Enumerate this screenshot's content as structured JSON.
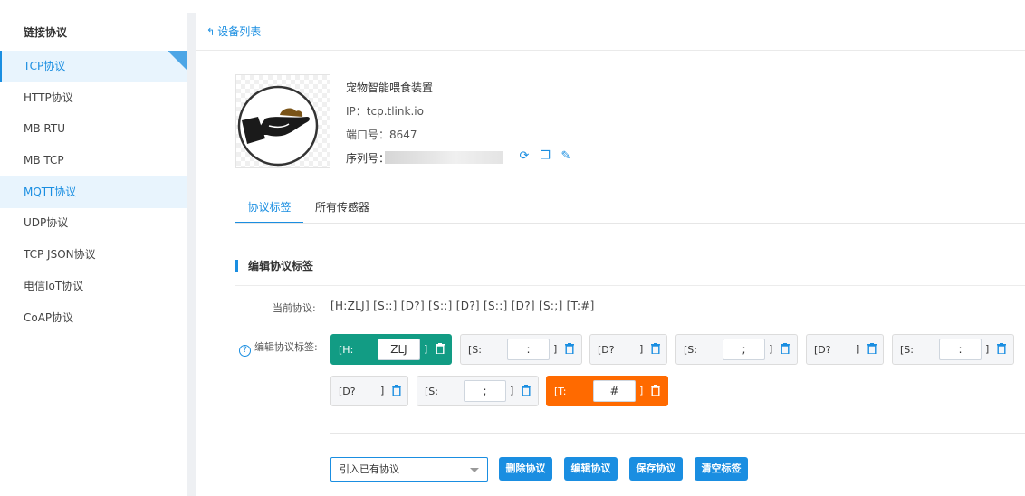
{
  "sidebar": {
    "title": "链接协议",
    "items": [
      {
        "label": "TCP协议"
      },
      {
        "label": "HTTP协议"
      },
      {
        "label": "MB  RTU"
      },
      {
        "label": "MB  TCP"
      },
      {
        "label": "MQTT协议"
      },
      {
        "label": "UDP协议"
      },
      {
        "label": "TCP  JSON协议"
      },
      {
        "label": "电信IoT协议"
      },
      {
        "label": "CoAP协议"
      }
    ]
  },
  "header": {
    "back_label": "设备列表"
  },
  "device": {
    "name": "宠物智能喂食装置",
    "ip": "IP：tcp.tlink.io",
    "port": "端口号：8647",
    "serial_label": "序列号："
  },
  "tabs": [
    {
      "label": "协议标签"
    },
    {
      "label": "所有传感器"
    }
  ],
  "section": {
    "title": "编辑协议标签",
    "current_label": "当前协议:",
    "current_value": "[H:ZLJ]  [S::]  [D?]  [S:;]  [D?]  [S::]  [D?]  [S:;]  [T:#]",
    "edit_label": "编辑协议标签:"
  },
  "tags": [
    {
      "prefix": "[H:",
      "value": "ZLJ",
      "close": "]"
    },
    {
      "prefix": "[S:",
      "value": ":",
      "close": "]"
    },
    {
      "prefix": "[D?",
      "value": "",
      "close": "]"
    },
    {
      "prefix": "[S:",
      "value": ";",
      "close": "]"
    },
    {
      "prefix": "[D?",
      "value": "",
      "close": "]"
    },
    {
      "prefix": "[S:",
      "value": ":",
      "close": "]"
    },
    {
      "prefix": "[D?",
      "value": "",
      "close": "]"
    },
    {
      "prefix": "[S:",
      "value": ";",
      "close": "]"
    },
    {
      "prefix": "[T:",
      "value": "#",
      "close": "]"
    }
  ],
  "actions": {
    "select_value": "引入已有协议",
    "delete": "删除协议",
    "edit": "编辑协议",
    "save": "保存协议",
    "clear": "清空标签"
  },
  "colors": {
    "accent": "#1a8ee1",
    "green_tag": "#129c84",
    "orange_tag": "#ff6a00"
  }
}
